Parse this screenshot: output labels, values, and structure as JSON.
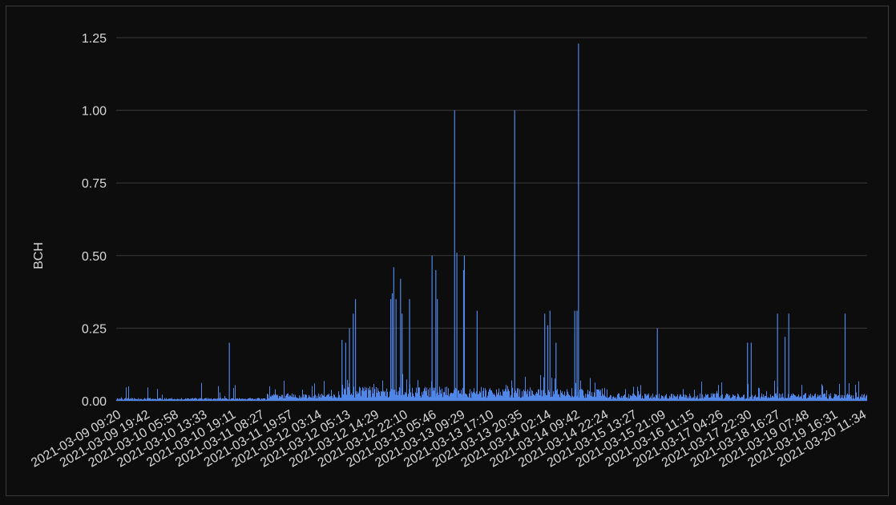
{
  "chart_data": {
    "type": "bar",
    "title": "",
    "xlabel": "",
    "ylabel": "BCH",
    "ylim": [
      0,
      1.25
    ],
    "yticks": [
      "0.00",
      "0.25",
      "0.50",
      "0.75",
      "1.00",
      "1.25"
    ],
    "x_tick_labels": [
      "2021-03-09 09:20",
      "2021-03-09 19:42",
      "2021-03-10 05:58",
      "2021-03-10 13:33",
      "2021-03-10 19:11",
      "2021-03-11 08:27",
      "2021-03-11 19:57",
      "2021-03-12 03:14",
      "2021-03-12 05:13",
      "2021-03-12 14:29",
      "2021-03-12 22:10",
      "2021-03-13 05:46",
      "2021-03-13 09:29",
      "2021-03-13 17:10",
      "2021-03-13 20:35",
      "2021-03-14 02:14",
      "2021-03-14 09:42",
      "2021-03-14 22:24",
      "2021-03-15 13:27",
      "2021-03-15 21:09",
      "2021-03-16 11:15",
      "2021-03-17 04:26",
      "2021-03-17 22:30",
      "2021-03-18 16:27",
      "2021-03-19 07:48",
      "2021-03-19 16:31",
      "2021-03-20 11:34"
    ],
    "grid": true,
    "legend": "none",
    "series": [
      {
        "color": "#4f86e8",
        "spikes": [
          {
            "t": 0.15,
            "v": 0.2
          },
          {
            "t": 0.3,
            "v": 0.21
          },
          {
            "t": 0.305,
            "v": 0.2
          },
          {
            "t": 0.31,
            "v": 0.25
          },
          {
            "t": 0.315,
            "v": 0.3
          },
          {
            "t": 0.318,
            "v": 0.35
          },
          {
            "t": 0.365,
            "v": 0.35
          },
          {
            "t": 0.367,
            "v": 0.37
          },
          {
            "t": 0.369,
            "v": 0.46
          },
          {
            "t": 0.372,
            "v": 0.35
          },
          {
            "t": 0.378,
            "v": 0.42
          },
          {
            "t": 0.38,
            "v": 0.3
          },
          {
            "t": 0.39,
            "v": 0.35
          },
          {
            "t": 0.42,
            "v": 0.5
          },
          {
            "t": 0.425,
            "v": 0.45
          },
          {
            "t": 0.427,
            "v": 0.35
          },
          {
            "t": 0.45,
            "v": 1.0
          },
          {
            "t": 0.453,
            "v": 0.51
          },
          {
            "t": 0.463,
            "v": 0.5
          },
          {
            "t": 0.462,
            "v": 0.45
          },
          {
            "t": 0.48,
            "v": 0.31
          },
          {
            "t": 0.53,
            "v": 1.0
          },
          {
            "t": 0.57,
            "v": 0.3
          },
          {
            "t": 0.574,
            "v": 0.26
          },
          {
            "t": 0.577,
            "v": 0.31
          },
          {
            "t": 0.585,
            "v": 0.2
          },
          {
            "t": 0.61,
            "v": 0.31
          },
          {
            "t": 0.613,
            "v": 0.31
          },
          {
            "t": 0.615,
            "v": 1.23
          },
          {
            "t": 0.72,
            "v": 0.25
          },
          {
            "t": 0.84,
            "v": 0.2
          },
          {
            "t": 0.845,
            "v": 0.2
          },
          {
            "t": 0.88,
            "v": 0.3
          },
          {
            "t": 0.89,
            "v": 0.22
          },
          {
            "t": 0.895,
            "v": 0.3
          },
          {
            "t": 0.97,
            "v": 0.3
          }
        ]
      }
    ]
  }
}
